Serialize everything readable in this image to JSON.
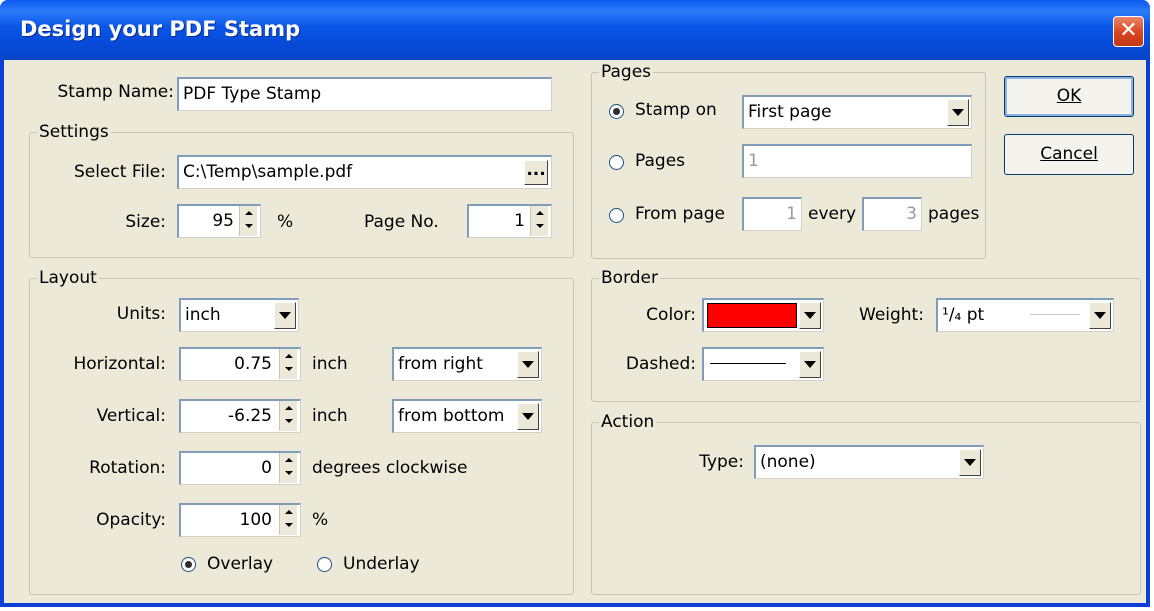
{
  "window": {
    "title": "Design your PDF Stamp",
    "close_glyph": "✕"
  },
  "stamp_name": {
    "label": "Stamp Name:",
    "value": "PDF Type Stamp"
  },
  "settings": {
    "legend": "Settings",
    "select_file_label": "Select File:",
    "select_file_value": "C:\\Temp\\sample.pdf",
    "browse_label": "...",
    "size_label": "Size:",
    "size_value": "95",
    "size_unit": "%",
    "page_no_label": "Page No.",
    "page_no_value": "1"
  },
  "layout": {
    "legend": "Layout",
    "units_label": "Units:",
    "units_value": "inch",
    "horizontal_label": "Horizontal:",
    "horizontal_value": "0.75",
    "horizontal_unit": "inch",
    "horizontal_ref": "from right",
    "vertical_label": "Vertical:",
    "vertical_value": "-6.25",
    "vertical_unit": "inch",
    "vertical_ref": "from bottom",
    "rotation_label": "Rotation:",
    "rotation_value": "0",
    "rotation_unit": "degrees clockwise",
    "opacity_label": "Opacity:",
    "opacity_value": "100",
    "opacity_unit": "%",
    "overlay_label": "Overlay",
    "underlay_label": "Underlay",
    "selected_mode": "Overlay"
  },
  "pages": {
    "legend": "Pages",
    "stamp_on_label": "Stamp on",
    "stamp_on_value": "First page",
    "pages_label": "Pages",
    "pages_value": "1",
    "from_page_label": "From page",
    "from_page_value": "1",
    "every_label": "every",
    "every_value": "3",
    "pages_suffix": "pages",
    "selected_option": "Stamp on"
  },
  "border": {
    "legend": "Border",
    "color_label": "Color:",
    "color_value": "#ff0000",
    "weight_label": "Weight:",
    "weight_value": "¹/₄ pt",
    "dashed_label": "Dashed:"
  },
  "action": {
    "legend": "Action",
    "type_label": "Type:",
    "type_value": "(none)"
  },
  "buttons": {
    "ok_label": "OK",
    "cancel_label": "Cancel"
  }
}
